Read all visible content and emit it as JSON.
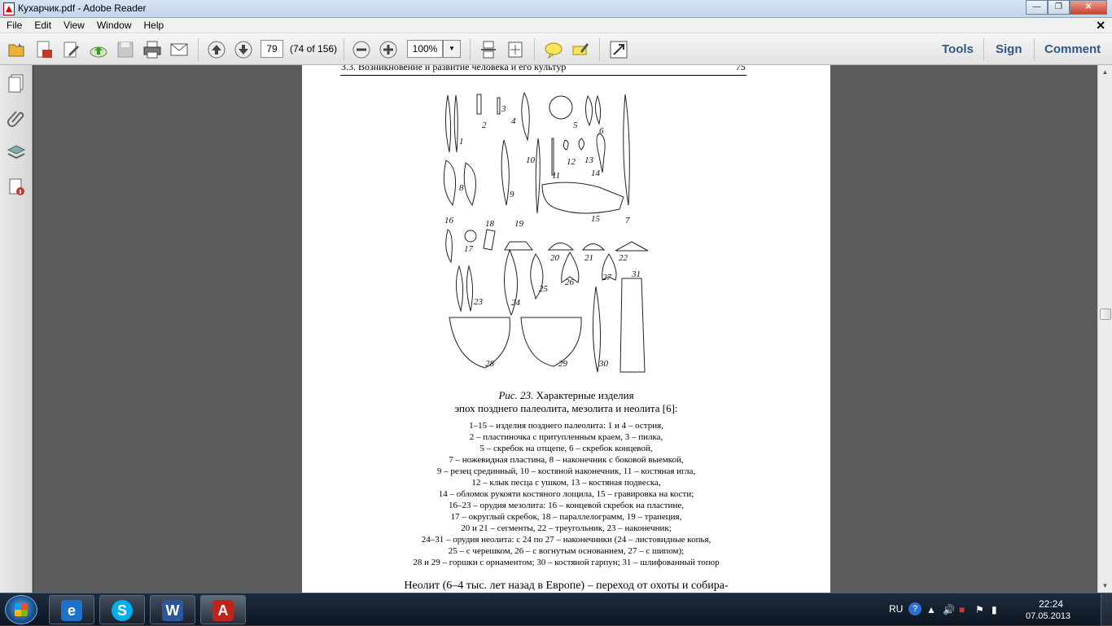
{
  "window": {
    "title": "Кухарчик.pdf - Adobe Reader",
    "minimize_icon": "minimize-icon",
    "maximize_icon": "restore-icon",
    "close_icon": "close-icon"
  },
  "menu": {
    "items": [
      {
        "label": "File"
      },
      {
        "label": "Edit"
      },
      {
        "label": "View"
      },
      {
        "label": "Window"
      },
      {
        "label": "Help"
      }
    ],
    "doc_close": "✕"
  },
  "toolbar": {
    "page_number": "79",
    "page_count": "(74 of 156)",
    "zoom": "100%",
    "tools_label": "Tools",
    "sign_label": "Sign",
    "comment_label": "Comment"
  },
  "document": {
    "running_header": "3.3. Возникновение и развитие человека и его культур",
    "running_header_page": "75",
    "figure_caption_label": "Рис. 23.",
    "figure_caption_title": " Характерные изделия",
    "figure_caption_line2": "эпох позднего палеолита, мезолита и неолита [6]:",
    "figure_numbers": [
      "1",
      "2",
      "3",
      "4",
      "5",
      "6",
      "7",
      "8",
      "9",
      "10",
      "11",
      "12",
      "13",
      "14",
      "15",
      "16",
      "17",
      "18",
      "19",
      "20",
      "21",
      "22",
      "23",
      "24",
      "25",
      "26",
      "27",
      "28",
      "29",
      "30",
      "31"
    ],
    "legend_lines": [
      "1–15 – изделия позднего палеолита: 1 и 4 – острия,",
      "2 – пластиночка с притупленным краем, 3 – пилка,",
      "5 – скребок на отщепе, 6 – скребок концевой,",
      "7 – ножевидная пластина, 8 – наконечник с боковой выемкой,",
      "9 – резец срединный, 10 – костяной наконечник, 11 – костяная игла,",
      "12 – клык песца с ушком, 13 – костяная подвеска,",
      "14 – обломок рукояти костяного лощила, 15 – гравировка на кости;",
      "16–23 – орудия мезолита: 16 – концевой скребок на пластине,",
      "17 – округлый скребок, 18 – параллелограмм, 19 – трапеция,",
      "20 и 21 – сегменты, 22 – треугольник, 23 – наконечник;",
      "24–31 – орудия неолита: с 24 по 27 – наконечники (24 – листовидные копья,",
      "25 – с черешком, 26 – с вогнутым основанием, 27 – с шипом);",
      "28 и 29 – горшки с орнаментом; 30 – костяной гарпун; 31 – шлифованный топор"
    ],
    "body_text_start": "Неолит (6–4 тыс. лет назад в Европе) – переход от охоты и собира-"
  },
  "taskbar": {
    "apps": [
      {
        "name": "internet-explorer",
        "label": "e"
      },
      {
        "name": "skype",
        "label": "S"
      },
      {
        "name": "word",
        "label": "W"
      },
      {
        "name": "adobe-reader",
        "label": "A"
      }
    ],
    "language": "RU",
    "time": "22:24",
    "date": "07.05.2013"
  },
  "colors": {
    "doc_background": "#5b5b5b",
    "accent_blue": "#2d5a8a",
    "taskbar": "#0d1622"
  }
}
